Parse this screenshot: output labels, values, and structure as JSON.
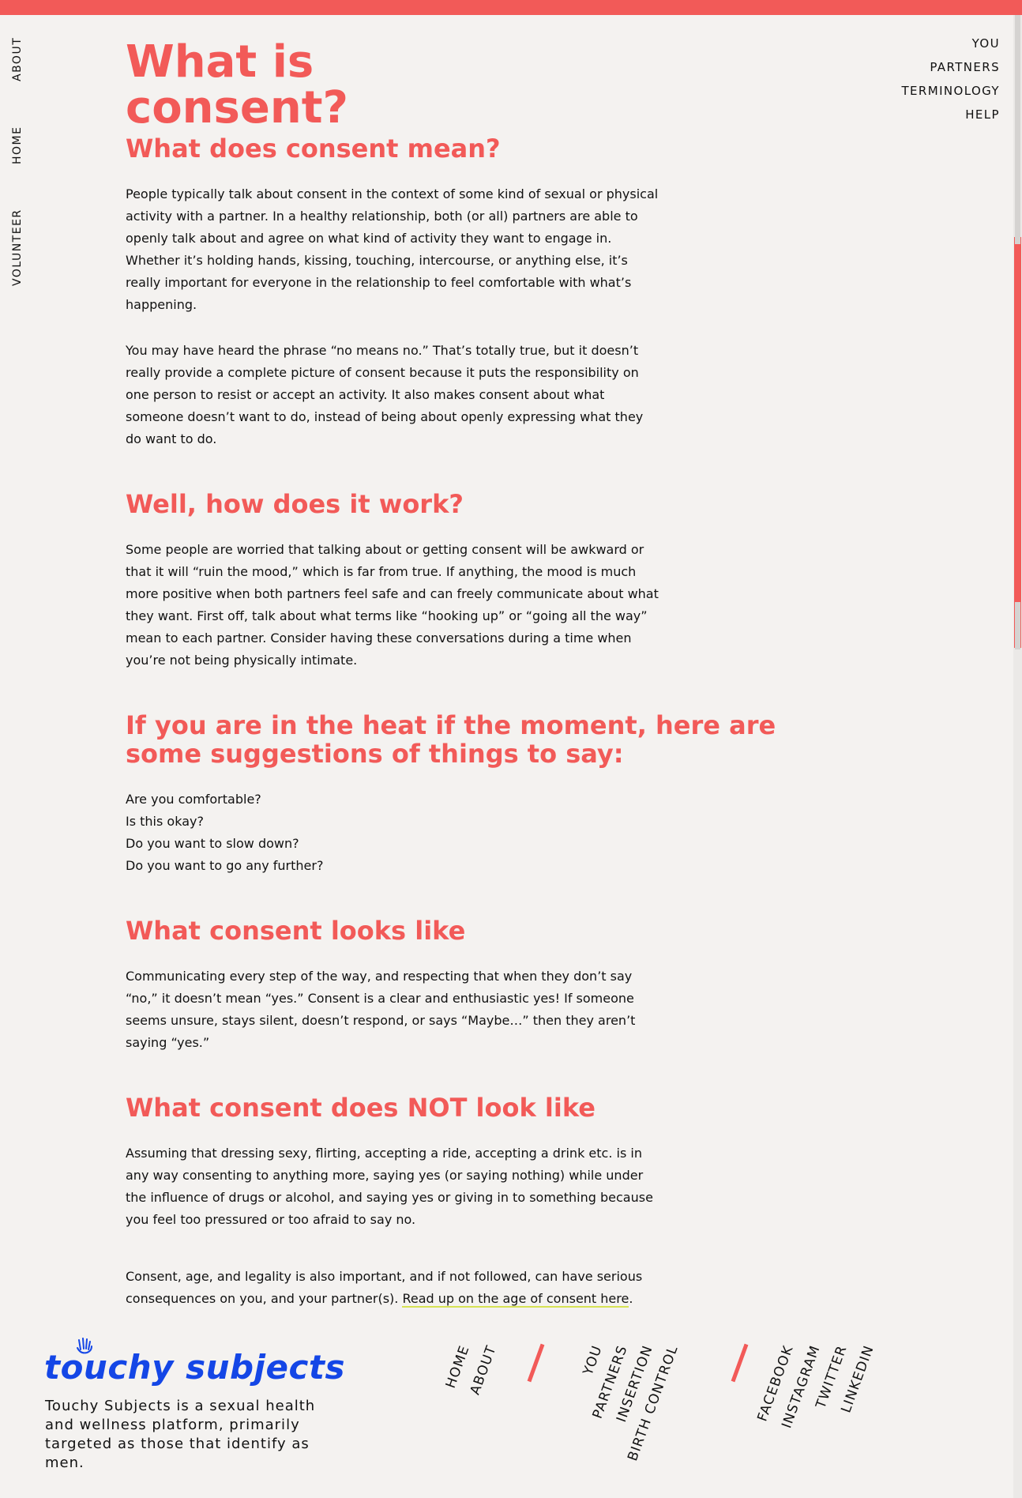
{
  "sidebar": {
    "items": [
      {
        "label": "ABOUT"
      },
      {
        "label": "HOME"
      },
      {
        "label": "VOLUNTEER"
      }
    ]
  },
  "topnav": {
    "items": [
      {
        "label": "YOU"
      },
      {
        "label": "PARTNERS"
      },
      {
        "label": "TERMINOLOGY"
      },
      {
        "label": "HELP"
      }
    ]
  },
  "main": {
    "title": "What is consent?",
    "sections": [
      {
        "heading": "What does consent mean?",
        "paragraphs": [
          "People typically talk about consent in the context of some kind of sexual or physical activity with a partner. In a healthy relationship, both (or all) partners are able to openly talk about and agree on what kind of activity they want to engage in. Whether it’s holding hands, kissing, touching, intercourse, or anything else, it’s really important for everyone in the relationship to feel comfortable with what’s happening.",
          "You may have heard the phrase “no means no.” That’s totally true, but it doesn’t really provide a complete picture of consent because it puts the responsibility on one person to resist or accept an activity. It also makes consent about what someone doesn’t want to do, instead of being about openly expressing what they do want to do."
        ]
      },
      {
        "heading": "Well, how does it work?",
        "paragraphs": [
          "Some people are worried that talking about or getting consent will be awkward or that it will “ruin the mood,” which is far from true. If anything, the mood is much more positive when both partners feel safe and can freely communicate about what they want. First off, talk about what terms like “hooking up” or “going all the way” mean to each partner. Consider having these conversations during a time when you’re not being physically intimate."
        ]
      },
      {
        "heading": "If you are in the heat if the moment, here are some suggestions of things to say:",
        "list": [
          "Are you comfortable?",
          "Is this okay?",
          "Do you want to slow down?",
          "Do you want to go any further?"
        ]
      },
      {
        "heading": "What consent looks like",
        "paragraphs": [
          "Communicating every step of the way, and respecting that when they don’t say “no,” it doesn’t mean “yes.” Consent is a clear and enthusiastic yes! If someone seems unsure, stays silent, doesn’t respond, or says “Maybe…” then they aren’t saying “yes.”"
        ]
      },
      {
        "heading": "What consent does NOT look like",
        "paragraphs": [
          "Assuming that dressing sexy, flirting, accepting a ride, accepting a drink etc. is in any way consenting to anything more, saying yes (or saying nothing) while under the influence of drugs or alcohol, and saying yes or giving in to something because you feel too pressured or too afraid to say no."
        ]
      }
    ],
    "closing": {
      "text": "Consent, age, and legality is also important, and if not followed, can have serious consequences on you, and your partner(s). ",
      "link": "Read up on the age of consent here",
      "end": "."
    }
  },
  "footer": {
    "logo": "touchy subjects",
    "description": "Touchy Subjects is a sexual health and wellness platform, primarily targeted as those that identify as men.",
    "nav_group_1": [
      "HOME",
      "ABOUT"
    ],
    "nav_group_2": [
      "YOU",
      "PARTNERS",
      "INSERTION",
      "BIRTH CONTROL"
    ],
    "nav_group_3": [
      "FACEBOOK",
      "INSTAGRAM",
      "TWITTER",
      "LINKEDIN"
    ]
  },
  "colors": {
    "accent": "#f25a58",
    "brand": "#1446e6",
    "background": "#f4f2f0",
    "link_underline": "#d6e253"
  }
}
